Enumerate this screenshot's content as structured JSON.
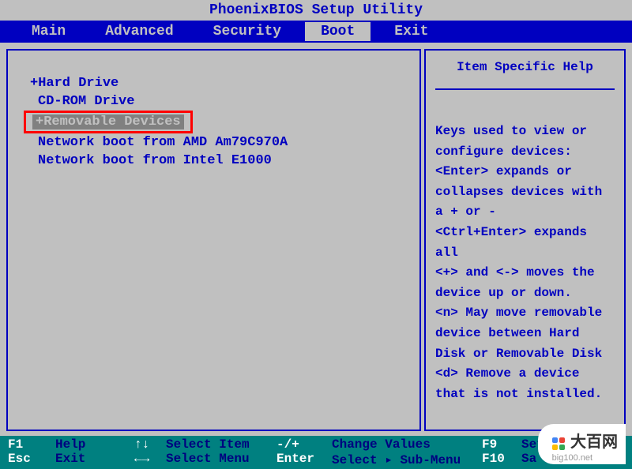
{
  "title": "PhoenixBIOS Setup Utility",
  "menu": [
    {
      "label": "Main",
      "active": false
    },
    {
      "label": "Advanced",
      "active": false
    },
    {
      "label": "Security",
      "active": false
    },
    {
      "label": "Boot",
      "active": true
    },
    {
      "label": "Exit",
      "active": false
    }
  ],
  "boot_items": [
    {
      "label": "+Hard Drive",
      "highlighted": false
    },
    {
      "label": "CD-ROM Drive",
      "highlighted": false
    },
    {
      "label": "+Removable Devices",
      "highlighted": true
    },
    {
      "label": "Network boot from AMD Am79C970A",
      "highlighted": false
    },
    {
      "label": "Network boot from Intel E1000",
      "highlighted": false
    }
  ],
  "help": {
    "title": "Item Specific Help",
    "text": "Keys used to view or configure devices:\n<Enter> expands or collapses devices with a + or -\n<Ctrl+Enter> expands all\n<+> and <-> moves the device up or down.\n<n> May move removable device between Hard Disk or Removable Disk\n<d> Remove a device that is not installed."
  },
  "footer": {
    "row1": [
      {
        "key": "F1",
        "label": "Help"
      },
      {
        "key": "↑↓",
        "label": "Select Item"
      },
      {
        "key": "-/+",
        "label": "Change Values"
      },
      {
        "key": "F9",
        "label": "Set"
      }
    ],
    "row2": [
      {
        "key": "Esc",
        "label": "Exit"
      },
      {
        "key": "←→",
        "label": "Select Menu"
      },
      {
        "key": "Enter",
        "label": "Select ▸ Sub-Menu"
      },
      {
        "key": "F10",
        "label": "Sa"
      }
    ]
  },
  "watermark": {
    "brand": "大百网",
    "url": "big100.net"
  }
}
